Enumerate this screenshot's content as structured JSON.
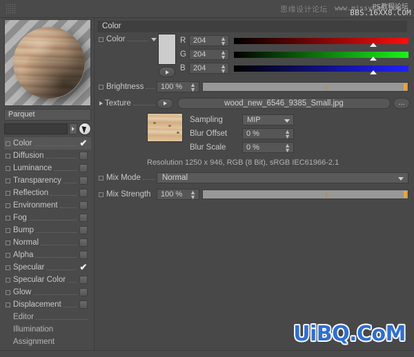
{
  "window": {
    "grip_icon": "grip-dots-icon"
  },
  "watermark": {
    "top_cn": "思缘设计论坛",
    "top_url": "www.missyuan.com",
    "top_cn2": "PS教程论坛",
    "top_bbs": "BBS.16XX8.COM",
    "bottom": "UiBQ.CoM",
    "bottom_color": "#2f6fd0"
  },
  "material": {
    "name": "Parquet",
    "preview_label": "material-preview-sphere",
    "search_value": "",
    "select_icon": "pointer-arrow-icon"
  },
  "channels": [
    {
      "label": "Color",
      "state": "check",
      "selected": true
    },
    {
      "label": "Diffusion",
      "state": "box",
      "selected": false
    },
    {
      "label": "Luminance",
      "state": "box",
      "selected": false
    },
    {
      "label": "Transparency",
      "state": "box",
      "selected": false
    },
    {
      "label": "Reflection",
      "state": "box",
      "selected": false
    },
    {
      "label": "Environment",
      "state": "box",
      "selected": false
    },
    {
      "label": "Fog",
      "state": "box",
      "selected": false
    },
    {
      "label": "Bump",
      "state": "box",
      "selected": false
    },
    {
      "label": "Normal",
      "state": "box",
      "selected": false
    },
    {
      "label": "Alpha",
      "state": "box",
      "selected": false
    },
    {
      "label": "Specular",
      "state": "check",
      "selected": false
    },
    {
      "label": "Specular Color",
      "state": "box",
      "selected": false
    },
    {
      "label": "Glow",
      "state": "box",
      "selected": false
    },
    {
      "label": "Displacement",
      "state": "box",
      "selected": false
    }
  ],
  "pages": [
    {
      "label": "Editor"
    },
    {
      "label": "Illumination"
    },
    {
      "label": "Assignment"
    }
  ],
  "panel": {
    "section_title": "Color",
    "color": {
      "label": "Color",
      "swatch_hex": "#cccccc",
      "channels": [
        {
          "name": "R",
          "value": "204",
          "gradient_to": "#ff0d0d",
          "marker_pct": 80
        },
        {
          "name": "G",
          "value": "204",
          "gradient_to": "#1cf01c",
          "marker_pct": 80
        },
        {
          "name": "B",
          "value": "204",
          "gradient_to": "#2020ff",
          "marker_pct": 80
        }
      ]
    },
    "brightness": {
      "label": "Brightness",
      "value": "100 %",
      "slider_pct": 100
    },
    "texture": {
      "label": "Texture",
      "file": "wood_new_6546_9385_Small.jpg",
      "browse_label": "...",
      "sampling_label": "Sampling",
      "sampling_value": "MIP",
      "blur_offset_label": "Blur Offset",
      "blur_offset_value": "0 %",
      "blur_scale_label": "Blur Scale",
      "blur_scale_value": "0 %",
      "resolution": "Resolution 1250 x 946, RGB (8 Bit), sRGB IEC61966-2.1"
    },
    "mix_mode": {
      "label": "Mix Mode",
      "value": "Normal"
    },
    "mix_strength": {
      "label": "Mix Strength",
      "value": "100 %",
      "slider_pct": 100
    }
  }
}
